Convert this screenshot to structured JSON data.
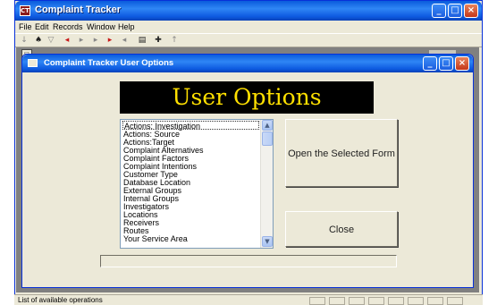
{
  "app": {
    "title": "Complaint Tracker",
    "icon_glyph": "CT"
  },
  "menu": [
    {
      "label": "File"
    },
    {
      "label": "Edit"
    },
    {
      "label": "Records"
    },
    {
      "label": "Window"
    },
    {
      "label": "Help"
    }
  ],
  "toolbar": {
    "icons": [
      "sort-ascending-icon",
      "find-icon",
      "filter-icon",
      "first-record-icon",
      "new-record-icon",
      "next-record-icon",
      "last-record-icon",
      "previous-record-icon",
      "design-view-icon",
      "new-record-plus-icon",
      "sort-descending-icon"
    ]
  },
  "child_window": {
    "title": "Complaint Tracker User Options"
  },
  "form": {
    "heading": "User Options",
    "heading_color": "#ffe000",
    "list_items": [
      "Actions: Investigation",
      "Actions: Source",
      "Actions:Target",
      "Complaint Alternatives",
      "Complaint Factors",
      "Complaint Intentions",
      "Customer Type",
      "Database Location",
      "External Groups",
      "Internal Groups",
      "Investigators",
      "Locations",
      "Receivers",
      "Routes",
      "Your Service Area"
    ],
    "open_button": "Open the Selected Form",
    "close_button": "Close"
  },
  "status": {
    "text": "List of available operations"
  },
  "colors": {
    "titlebar": "#0a5bdc",
    "mdi_background": "#808080",
    "banner_background": "#000000"
  }
}
